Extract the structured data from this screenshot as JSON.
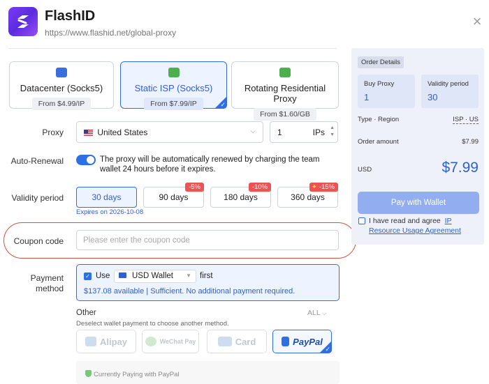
{
  "header": {
    "title": "FlashID",
    "url": "https://www.flashid.net/global-proxy",
    "close_icon": "×"
  },
  "proxy_types": [
    {
      "name": "Datacenter (Socks5)",
      "price": "From $4.99/IP",
      "selected": false,
      "icon": "server-icon",
      "icon_color": "#3a6fe0"
    },
    {
      "name": "Static ISP (Socks5)",
      "price": "From $7.99/IP",
      "selected": true,
      "icon": "home-wifi-icon",
      "icon_color": "#4caf50"
    },
    {
      "name": "Rotating Residential Proxy",
      "price": "From $1.60/GB",
      "selected": false,
      "icon": "rotating-home-icon",
      "icon_color": "#4caf50"
    }
  ],
  "proxy": {
    "label": "Proxy",
    "country": "United States",
    "quantity": "1",
    "unit": "IPs"
  },
  "auto_renewal": {
    "label": "Auto-Renewal",
    "enabled": true,
    "text": "The proxy will be automatically renewed by charging the team wallet 24 hours before it expires."
  },
  "validity": {
    "label": "Validity period",
    "options": [
      {
        "label": "30 days",
        "badge": "",
        "selected": true
      },
      {
        "label": "90 days",
        "badge": "-5%",
        "selected": false
      },
      {
        "label": "180 days",
        "badge": "-10%",
        "selected": false
      },
      {
        "label": "360 days",
        "badge": "-15%",
        "selected": false
      }
    ],
    "expires": "Expires on 2026-10-08"
  },
  "coupon": {
    "label": "Coupon code",
    "placeholder": "Please enter the coupon code"
  },
  "payment": {
    "label_line1": "Payment",
    "label_line2": "method",
    "use_label": "Use",
    "wallet": "USD Wallet",
    "first_label": "first",
    "status": "$137.08 available | Sufficient. No additional payment required.",
    "other_title": "Other",
    "other_all": "ALL",
    "other_desc": "Deselect wallet payment to choose another method.",
    "methods": [
      {
        "label": "Alipay",
        "selected": false
      },
      {
        "label": "WeChat Pay",
        "selected": false
      },
      {
        "label": "Card",
        "selected": false
      },
      {
        "label": "PayPal",
        "selected": true
      }
    ],
    "currently_paying": "Currently Paying with PayPal"
  },
  "order": {
    "title": "Order Details",
    "buy_proxy_label": "Buy Proxy",
    "buy_proxy_value": "1",
    "validity_label": "Validity period",
    "validity_value": "30",
    "type_region_label": "Type · Region",
    "type_region_value": "ISP · US",
    "amount_label": "Order amount",
    "amount_value": "$7.99",
    "currency_label": "USD",
    "total": "$7.99",
    "pay_button": "Pay with Wallet",
    "agree_text": "I have read and agree",
    "agree_link_1": "IP",
    "agree_link_2": "Resource Usage Agreement"
  },
  "colors": {
    "accent": "#2f6fe6",
    "badge_red": "#f05252",
    "coupon_highlight": "#c9573e",
    "logo": "#6a35e8"
  }
}
